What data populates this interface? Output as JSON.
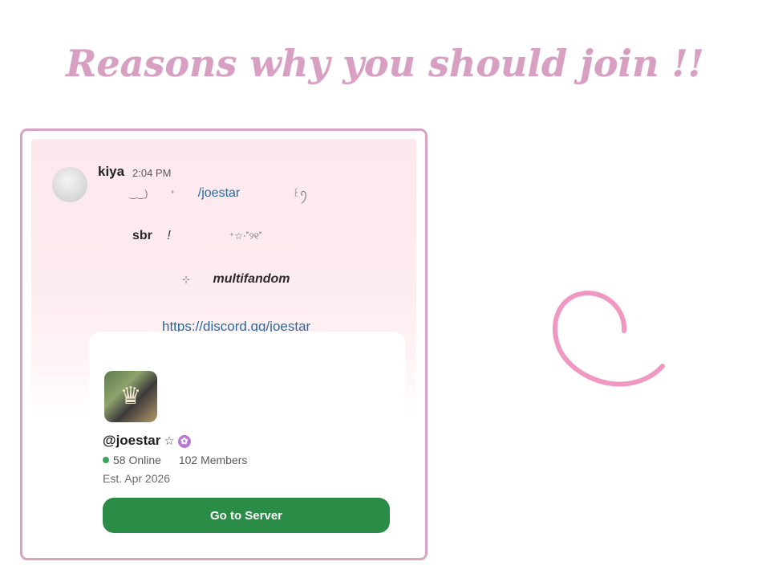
{
  "headline": "Reasons why you should join !!",
  "message": {
    "username": "kiya",
    "time": "2:04 PM",
    "line1": {
      "deco_left": "⠀ ‿‿) ⠀ ⠀ ⁺",
      "link": "/joestar",
      "deco_right": "⠀ ⠀ ⠀ ⠀ ⠀ ꒰ꪆ"
    },
    "line2": {
      "bold": "sbr",
      "bang": "!",
      "deco": "⠀ ⠀ ⠀ ⠀ ⁺☆⋅˚୨୧˚"
    },
    "line3": {
      "deco": "⊹",
      "text": "multifandom"
    },
    "invite_link": "https://discord.gg/joestar"
  },
  "embed": {
    "server_name": "@joestar",
    "star": "☆",
    "badge_icon": "flower-badge-icon",
    "online": "58 Online",
    "members": "102 Members",
    "established": "Est. Apr 2026",
    "button_label": "Go to Server"
  },
  "colors": {
    "headline": "#d79fc1",
    "card_border": "#d8a3c4",
    "button": "#2a8c46",
    "link": "#2a6a9e",
    "online_dot": "#3aa55d",
    "loader": "#f098c2"
  }
}
